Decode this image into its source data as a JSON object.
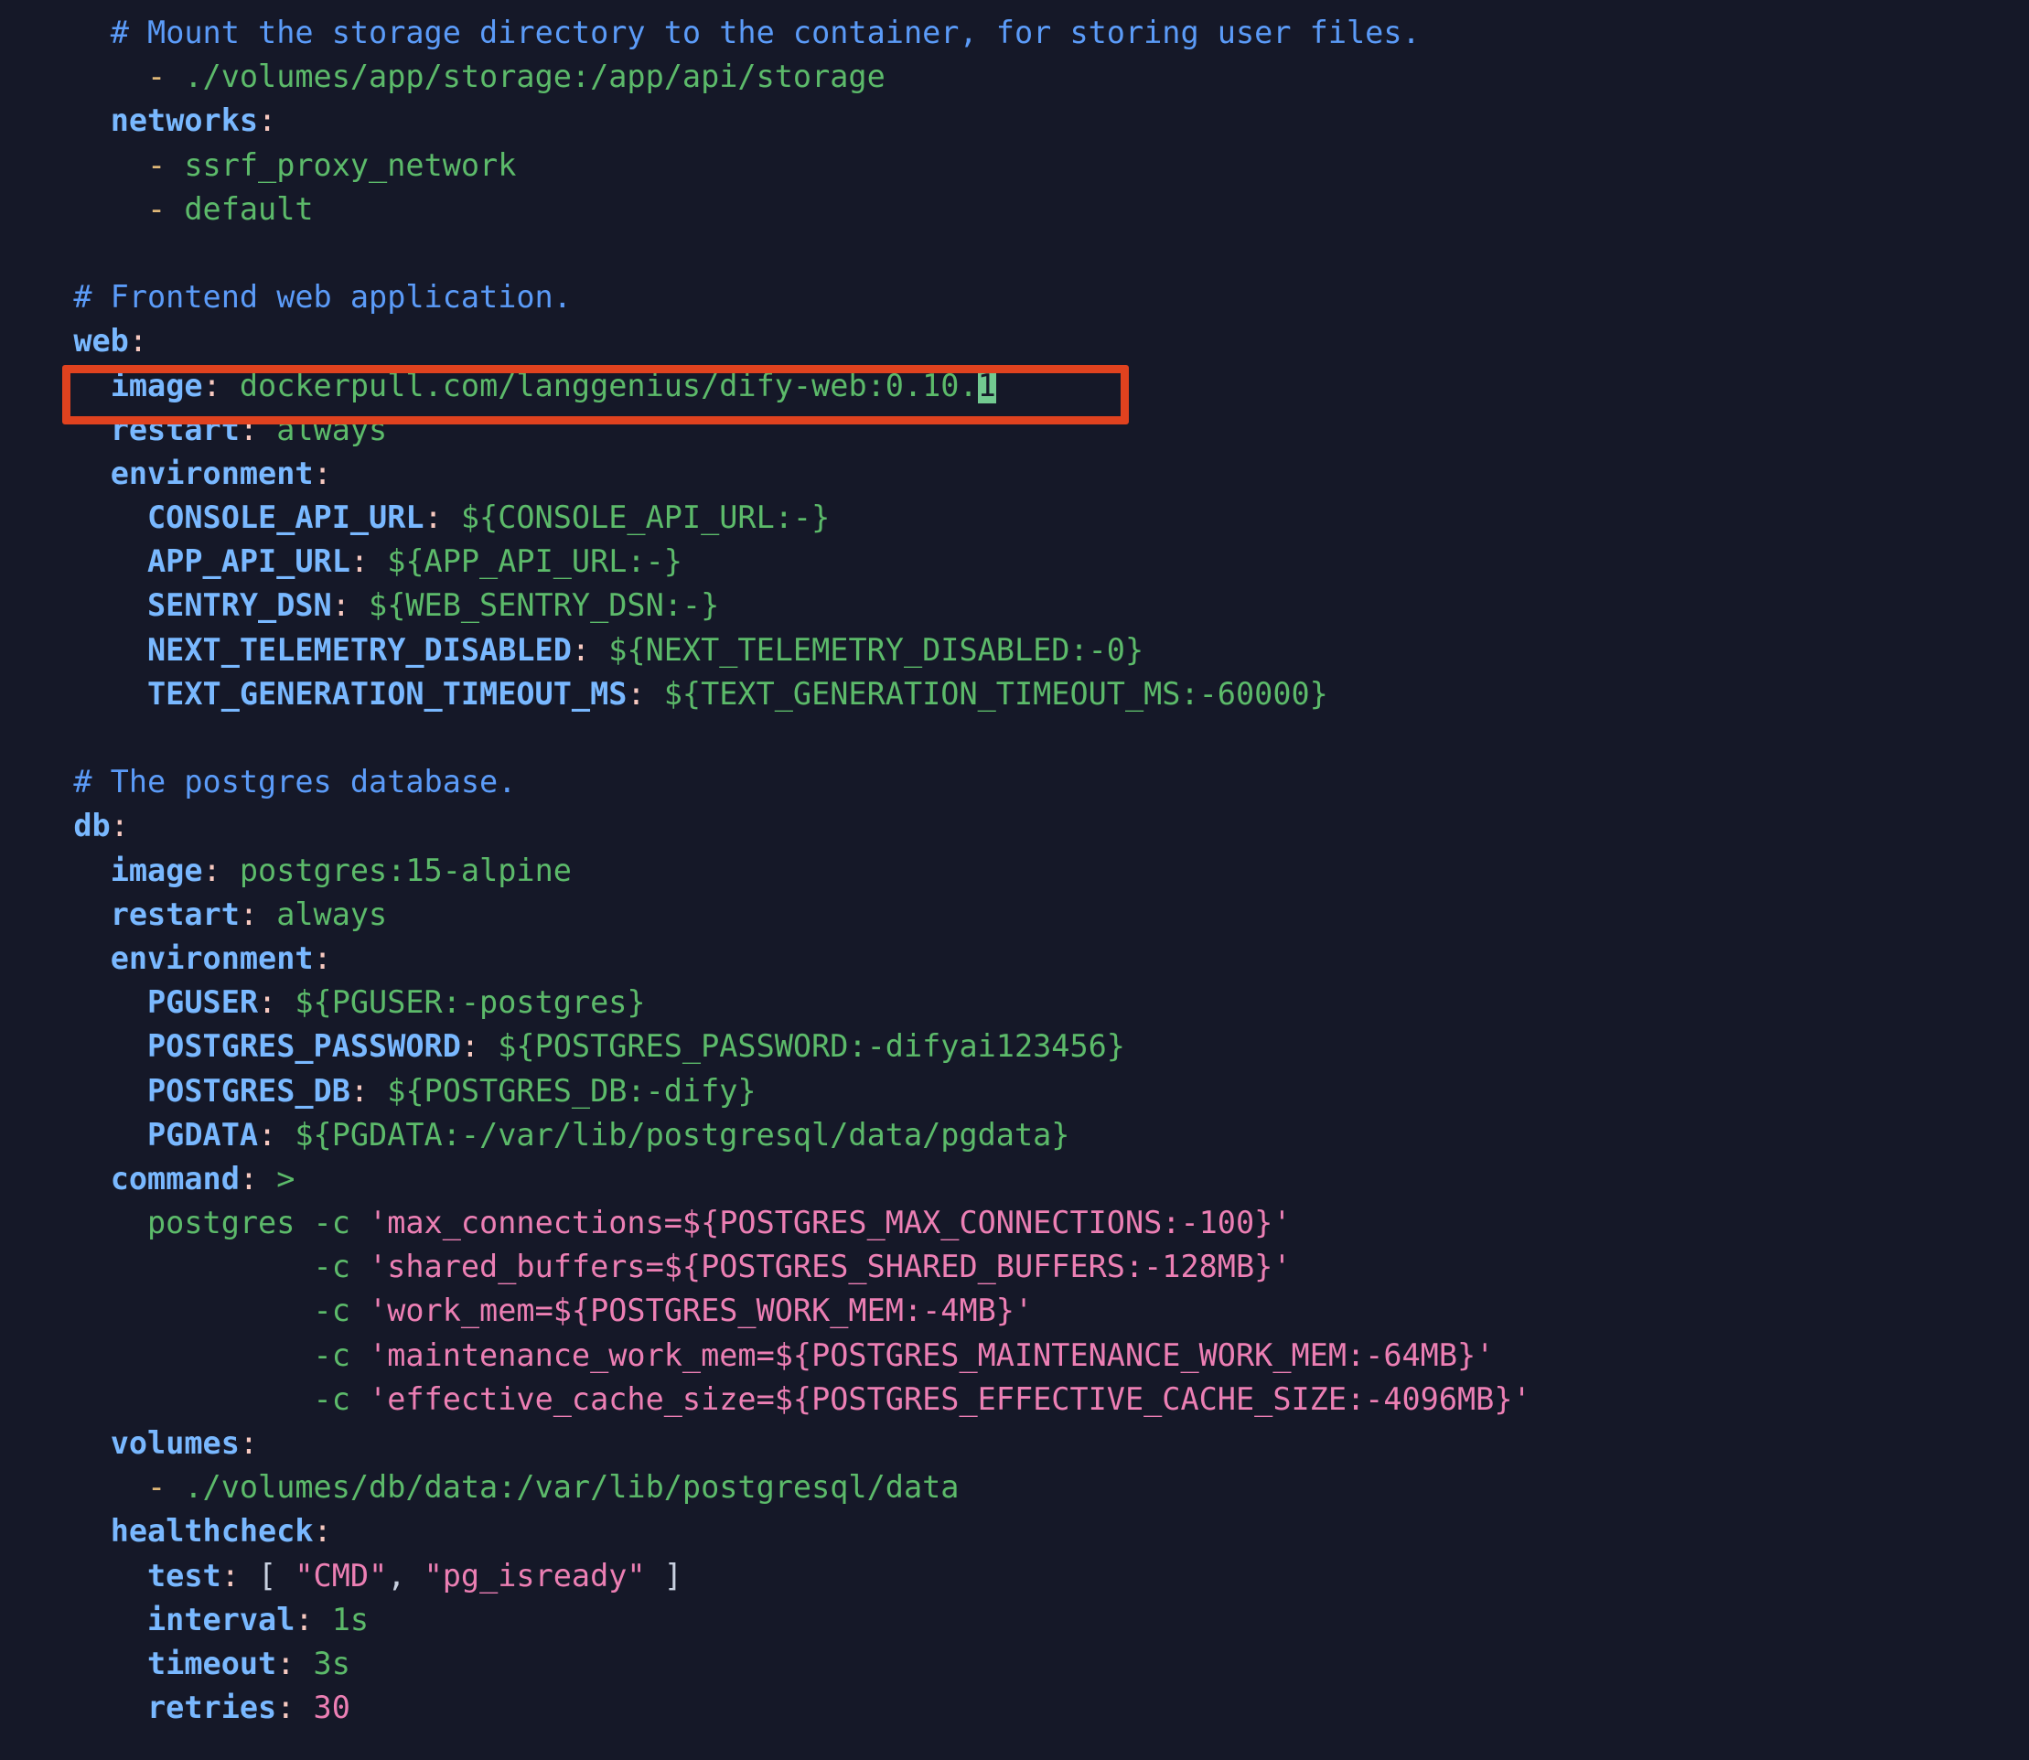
{
  "editor": {
    "language": "yaml",
    "filename_implied": "docker-compose.yaml",
    "background_color": "#151828",
    "cursor_color": "#72c990",
    "annotation_box_color": "#e0421f"
  },
  "colors": {
    "comment": "#5b9bf8",
    "key": "#79b8ff",
    "colon": "#f7c9c0",
    "string": "#5cba6a",
    "list_dash": "#e0b878",
    "number": "#ec7fb4",
    "quoted_string": "#ec7fb4",
    "plain_text": "#c8d0e0"
  },
  "annotation": {
    "target_line_text": "image: dockerpull.com/langgenius/dify-web:0.10.1",
    "cursor_char": "1"
  },
  "lines": [
    {
      "id": "l1",
      "indent": "    ",
      "segments": [
        {
          "t": "comment",
          "v": "# Mount the storage directory to the container, for storing user files."
        }
      ]
    },
    {
      "id": "l2",
      "indent": "      ",
      "segments": [
        {
          "t": "dash",
          "v": "- "
        },
        {
          "t": "string",
          "v": "./volumes/app/storage:/app/api/storage"
        }
      ]
    },
    {
      "id": "l3",
      "indent": "    ",
      "segments": [
        {
          "t": "key",
          "v": "networks"
        },
        {
          "t": "colon",
          "v": ":"
        }
      ]
    },
    {
      "id": "l4",
      "indent": "      ",
      "segments": [
        {
          "t": "dash",
          "v": "- "
        },
        {
          "t": "string",
          "v": "ssrf_proxy_network"
        }
      ]
    },
    {
      "id": "l5",
      "indent": "      ",
      "segments": [
        {
          "t": "dash",
          "v": "- "
        },
        {
          "t": "string",
          "v": "default"
        }
      ]
    },
    {
      "id": "l6",
      "indent": "",
      "segments": []
    },
    {
      "id": "l7",
      "indent": "  ",
      "segments": [
        {
          "t": "comment",
          "v": "# Frontend web application."
        }
      ]
    },
    {
      "id": "l8",
      "indent": "  ",
      "segments": [
        {
          "t": "key",
          "v": "web"
        },
        {
          "t": "colon",
          "v": ":"
        }
      ]
    },
    {
      "id": "l9",
      "indent": "    ",
      "highlighted": true,
      "segments": [
        {
          "t": "key",
          "v": "image"
        },
        {
          "t": "colon",
          "v": ":"
        },
        {
          "t": "string",
          "v": " dockerpull.com/langgenius/dify-web:0.10."
        },
        {
          "t": "cursor",
          "v": "1"
        }
      ]
    },
    {
      "id": "l10",
      "indent": "    ",
      "segments": [
        {
          "t": "key",
          "v": "restart"
        },
        {
          "t": "colon",
          "v": ":"
        },
        {
          "t": "string",
          "v": " always"
        }
      ]
    },
    {
      "id": "l11",
      "indent": "    ",
      "segments": [
        {
          "t": "key",
          "v": "environment"
        },
        {
          "t": "colon",
          "v": ":"
        }
      ]
    },
    {
      "id": "l12",
      "indent": "      ",
      "segments": [
        {
          "t": "key",
          "v": "CONSOLE_API_URL"
        },
        {
          "t": "colon",
          "v": ":"
        },
        {
          "t": "string",
          "v": " ${CONSOLE_API_URL:-}"
        }
      ]
    },
    {
      "id": "l13",
      "indent": "      ",
      "segments": [
        {
          "t": "key",
          "v": "APP_API_URL"
        },
        {
          "t": "colon",
          "v": ":"
        },
        {
          "t": "string",
          "v": " ${APP_API_URL:-}"
        }
      ]
    },
    {
      "id": "l14",
      "indent": "      ",
      "segments": [
        {
          "t": "key",
          "v": "SENTRY_DSN"
        },
        {
          "t": "colon",
          "v": ":"
        },
        {
          "t": "string",
          "v": " ${WEB_SENTRY_DSN:-}"
        }
      ]
    },
    {
      "id": "l15",
      "indent": "      ",
      "segments": [
        {
          "t": "key",
          "v": "NEXT_TELEMETRY_DISABLED"
        },
        {
          "t": "colon",
          "v": ":"
        },
        {
          "t": "string",
          "v": " ${NEXT_TELEMETRY_DISABLED:-0}"
        }
      ]
    },
    {
      "id": "l16",
      "indent": "      ",
      "segments": [
        {
          "t": "key",
          "v": "TEXT_GENERATION_TIMEOUT_MS"
        },
        {
          "t": "colon",
          "v": ":"
        },
        {
          "t": "string",
          "v": " ${TEXT_GENERATION_TIMEOUT_MS:-60000}"
        }
      ]
    },
    {
      "id": "l17",
      "indent": "",
      "segments": []
    },
    {
      "id": "l18",
      "indent": "  ",
      "segments": [
        {
          "t": "comment",
          "v": "# The postgres database."
        }
      ]
    },
    {
      "id": "l19",
      "indent": "  ",
      "segments": [
        {
          "t": "key",
          "v": "db"
        },
        {
          "t": "colon",
          "v": ":"
        }
      ]
    },
    {
      "id": "l20",
      "indent": "    ",
      "segments": [
        {
          "t": "key",
          "v": "image"
        },
        {
          "t": "colon",
          "v": ":"
        },
        {
          "t": "string",
          "v": " postgres:15-alpine"
        }
      ]
    },
    {
      "id": "l21",
      "indent": "    ",
      "segments": [
        {
          "t": "key",
          "v": "restart"
        },
        {
          "t": "colon",
          "v": ":"
        },
        {
          "t": "string",
          "v": " always"
        }
      ]
    },
    {
      "id": "l22",
      "indent": "    ",
      "segments": [
        {
          "t": "key",
          "v": "environment"
        },
        {
          "t": "colon",
          "v": ":"
        }
      ]
    },
    {
      "id": "l23",
      "indent": "      ",
      "segments": [
        {
          "t": "key",
          "v": "PGUSER"
        },
        {
          "t": "colon",
          "v": ":"
        },
        {
          "t": "string",
          "v": " ${PGUSER:-postgres}"
        }
      ]
    },
    {
      "id": "l24",
      "indent": "      ",
      "segments": [
        {
          "t": "key",
          "v": "POSTGRES_PASSWORD"
        },
        {
          "t": "colon",
          "v": ":"
        },
        {
          "t": "string",
          "v": " ${POSTGRES_PASSWORD:-difyai123456}"
        }
      ]
    },
    {
      "id": "l25",
      "indent": "      ",
      "segments": [
        {
          "t": "key",
          "v": "POSTGRES_DB"
        },
        {
          "t": "colon",
          "v": ":"
        },
        {
          "t": "string",
          "v": " ${POSTGRES_DB:-dify}"
        }
      ]
    },
    {
      "id": "l26",
      "indent": "      ",
      "segments": [
        {
          "t": "key",
          "v": "PGDATA"
        },
        {
          "t": "colon",
          "v": ":"
        },
        {
          "t": "string",
          "v": " ${PGDATA:-/var/lib/postgresql/data/pgdata}"
        }
      ]
    },
    {
      "id": "l27",
      "indent": "    ",
      "segments": [
        {
          "t": "key",
          "v": "command"
        },
        {
          "t": "colon",
          "v": ":"
        },
        {
          "t": "string",
          "v": " >"
        }
      ]
    },
    {
      "id": "l28",
      "indent": "      ",
      "segments": [
        {
          "t": "string",
          "v": "postgres -c "
        },
        {
          "t": "quoted",
          "v": "'max_connections=${POSTGRES_MAX_CONNECTIONS:-100}'"
        }
      ]
    },
    {
      "id": "l29",
      "indent": "               ",
      "segments": [
        {
          "t": "string",
          "v": "-c "
        },
        {
          "t": "quoted",
          "v": "'shared_buffers=${POSTGRES_SHARED_BUFFERS:-128MB}'"
        }
      ]
    },
    {
      "id": "l30",
      "indent": "               ",
      "segments": [
        {
          "t": "string",
          "v": "-c "
        },
        {
          "t": "quoted",
          "v": "'work_mem=${POSTGRES_WORK_MEM:-4MB}'"
        }
      ]
    },
    {
      "id": "l31",
      "indent": "               ",
      "segments": [
        {
          "t": "string",
          "v": "-c "
        },
        {
          "t": "quoted",
          "v": "'maintenance_work_mem=${POSTGRES_MAINTENANCE_WORK_MEM:-64MB}'"
        }
      ]
    },
    {
      "id": "l32",
      "indent": "               ",
      "segments": [
        {
          "t": "string",
          "v": "-c "
        },
        {
          "t": "quoted",
          "v": "'effective_cache_size=${POSTGRES_EFFECTIVE_CACHE_SIZE:-4096MB}'"
        }
      ]
    },
    {
      "id": "l33",
      "indent": "    ",
      "segments": [
        {
          "t": "key",
          "v": "volumes"
        },
        {
          "t": "colon",
          "v": ":"
        }
      ]
    },
    {
      "id": "l34",
      "indent": "      ",
      "segments": [
        {
          "t": "dash",
          "v": "- "
        },
        {
          "t": "string",
          "v": "./volumes/db/data:/var/lib/postgresql/data"
        }
      ]
    },
    {
      "id": "l35",
      "indent": "    ",
      "segments": [
        {
          "t": "key",
          "v": "healthcheck"
        },
        {
          "t": "colon",
          "v": ":"
        }
      ]
    },
    {
      "id": "l36",
      "indent": "      ",
      "segments": [
        {
          "t": "key",
          "v": "test"
        },
        {
          "t": "colon",
          "v": ":"
        },
        {
          "t": "plain",
          "v": " [ "
        },
        {
          "t": "quoted",
          "v": "\"CMD\""
        },
        {
          "t": "plain",
          "v": ", "
        },
        {
          "t": "quoted",
          "v": "\"pg_isready\""
        },
        {
          "t": "plain",
          "v": " ]"
        }
      ]
    },
    {
      "id": "l37",
      "indent": "      ",
      "segments": [
        {
          "t": "key",
          "v": "interval"
        },
        {
          "t": "colon",
          "v": ":"
        },
        {
          "t": "string",
          "v": " 1s"
        }
      ]
    },
    {
      "id": "l38",
      "indent": "      ",
      "segments": [
        {
          "t": "key",
          "v": "timeout"
        },
        {
          "t": "colon",
          "v": ":"
        },
        {
          "t": "string",
          "v": " 3s"
        }
      ]
    },
    {
      "id": "l39",
      "indent": "      ",
      "segments": [
        {
          "t": "key",
          "v": "retries"
        },
        {
          "t": "colon",
          "v": ":"
        },
        {
          "t": "number",
          "v": " 30"
        }
      ]
    }
  ]
}
